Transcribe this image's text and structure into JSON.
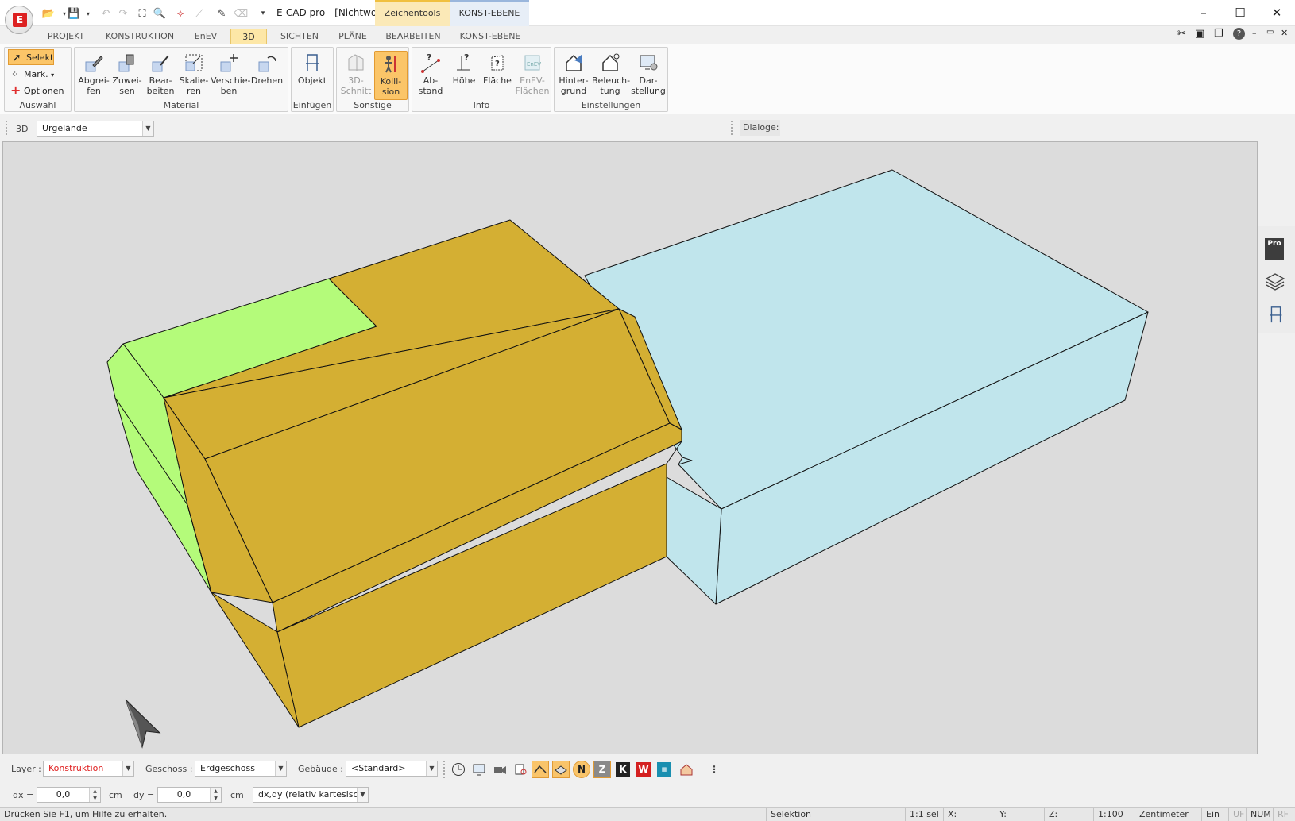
{
  "titlebar": {
    "app_logo": "E",
    "doc_title": "E-CAD pro - [Nichtwo...",
    "context_tab_1": "Zeichentools",
    "context_tab_2": "KONST-EBENE",
    "minimize": "–",
    "maximize": "☐",
    "close": "✕"
  },
  "ribbon_tabs": [
    "PROJEKT",
    "KONSTRUKTION",
    "EnEV",
    "3D",
    "SICHTEN",
    "PLÄNE",
    "BEARBEITEN",
    "KONST-EBENE"
  ],
  "active_tab": "3D",
  "groups": {
    "auswahl": {
      "label": "Auswahl",
      "selekt": "Selekt",
      "mark": "Mark.",
      "optionen": "Optionen"
    },
    "material": {
      "label": "Material",
      "buttons": [
        "Abgrei-\nfen",
        "Zuwei-\nsen",
        "Bear-\nbeiten",
        "Skalie-\nren",
        "Verschie-\nben",
        "Drehen"
      ]
    },
    "einfuegen": {
      "label": "Einfügen",
      "buttons": [
        "Objekt"
      ]
    },
    "sonstige": {
      "label": "Sonstige",
      "buttons": [
        "3D-\nSchnitt",
        "Kolli-\nsion"
      ]
    },
    "info": {
      "label": "Info",
      "buttons": [
        "Ab-\nstand",
        "Höhe",
        "Fläche",
        "EnEV-\nFlächen"
      ]
    },
    "einstellungen": {
      "label": "Einstellungen",
      "buttons": [
        "Hinter-\ngrund",
        "Beleuch-\ntung",
        "Dar-\nstellung"
      ]
    }
  },
  "viewbar": {
    "view_label": "3D",
    "view_combo": "Urgelände",
    "dialoge_label": "Dialoge:"
  },
  "sidestrip": {
    "pro_badge": "Pro"
  },
  "bottombar": {
    "layer_label": "Layer :",
    "layer_value": "Konstruktion",
    "geschoss_label": "Geschoss :",
    "geschoss_value": "Erdgeschoss",
    "gebaeude_label": "Gebäude :",
    "gebaeude_value": "<Standard>",
    "toggle_n": "N",
    "toggle_z": "Z",
    "toggle_k": "K",
    "toggle_w": "W",
    "dx_label": "dx =",
    "dx_value": "0,0",
    "dx_unit": "cm",
    "dy_label": "dy =",
    "dy_value": "0,0",
    "dy_unit": "cm",
    "coord_mode": "dx,dy (relativ kartesisch)"
  },
  "statusbar": {
    "help": "Drücken Sie F1, um Hilfe zu erhalten.",
    "mode": "Selektion",
    "scale_sel": "1:1 sel",
    "x": "X:",
    "y": "Y:",
    "z": "Z:",
    "scale": "1:100",
    "unit": "Zentimeter",
    "ein": "Ein",
    "uf": "UF",
    "num": "NUM",
    "rf": "RF"
  },
  "colors": {
    "building_gold": "#d4af33",
    "roof_green": "#b4fb7a",
    "terrain_blue": "#c0e5ec",
    "viewport_bg": "#dcdcdc",
    "active_tab": "#fde7a7",
    "layer_red": "#e02020"
  }
}
